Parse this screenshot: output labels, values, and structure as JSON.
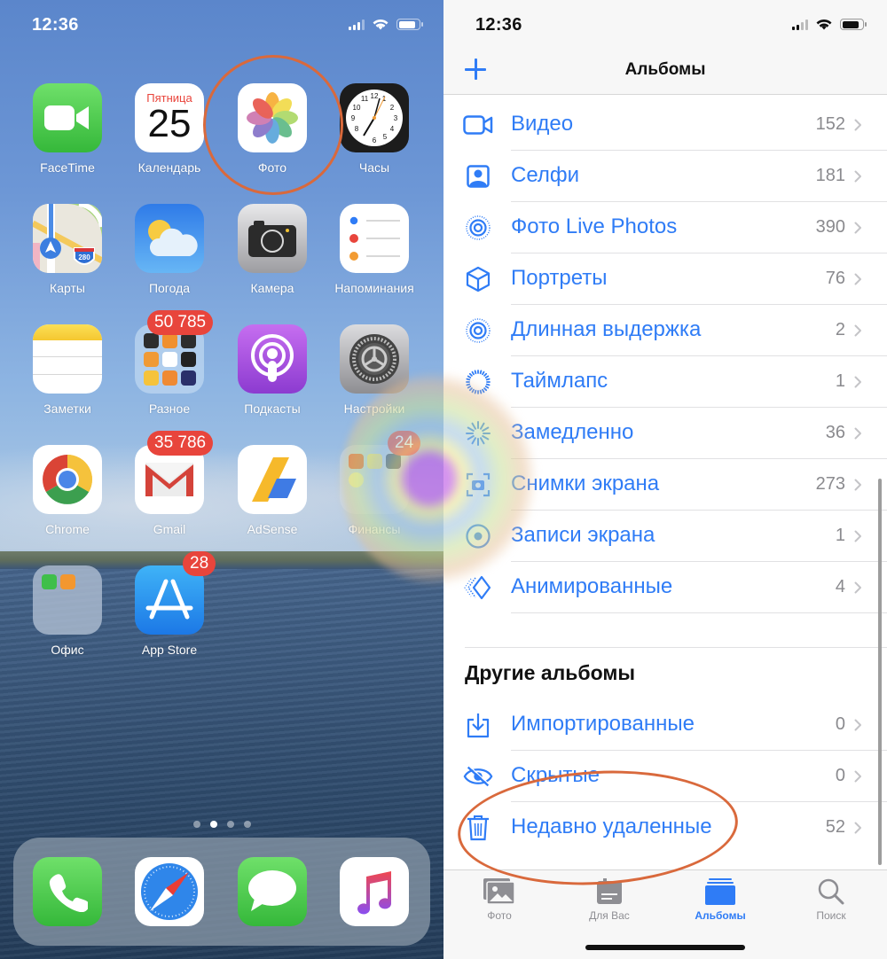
{
  "home_screen": {
    "status_bar": {
      "time": "12:36"
    },
    "apps": [
      {
        "name": "FaceTime",
        "icon": "facetime-icon"
      },
      {
        "name": "Календарь",
        "icon": "calendar-icon",
        "weekday": "Пятница",
        "day": "25"
      },
      {
        "name": "Фото",
        "icon": "photos-icon",
        "highlighted": true
      },
      {
        "name": "Часы",
        "icon": "clock-icon"
      },
      {
        "name": "Карты",
        "icon": "maps-icon",
        "route_shield": "280"
      },
      {
        "name": "Погода",
        "icon": "weather-icon"
      },
      {
        "name": "Камера",
        "icon": "camera-icon"
      },
      {
        "name": "Напоминания",
        "icon": "reminders-icon"
      },
      {
        "name": "Заметки",
        "icon": "notes-icon"
      },
      {
        "name": "Разное",
        "icon": "folder-icon",
        "badge": "50 785"
      },
      {
        "name": "Подкасты",
        "icon": "podcasts-icon"
      },
      {
        "name": "Настройки",
        "icon": "settings-icon"
      },
      {
        "name": "Chrome",
        "icon": "chrome-icon"
      },
      {
        "name": "Gmail",
        "icon": "gmail-icon",
        "badge": "35 786"
      },
      {
        "name": "AdSense",
        "icon": "adsense-icon"
      },
      {
        "name": "Финансы",
        "icon": "folder-icon",
        "badge": "24"
      },
      {
        "name": "Офис",
        "icon": "folder-icon"
      },
      {
        "name": "App Store",
        "icon": "appstore-icon",
        "badge": "28"
      }
    ],
    "page_indicator": {
      "pages": 4,
      "current": 2
    },
    "dock": [
      {
        "name": "Телефон",
        "icon": "phone-icon"
      },
      {
        "name": "Safari",
        "icon": "safari-icon"
      },
      {
        "name": "Сообщения",
        "icon": "messages-icon"
      },
      {
        "name": "Музыка",
        "icon": "music-icon"
      }
    ]
  },
  "albums_screen": {
    "status_bar": {
      "time": "12:36"
    },
    "nav": {
      "title": "Альбомы",
      "add_button": "plus-icon"
    },
    "media_types": [
      {
        "label": "Видео",
        "count": "152",
        "icon": "video-icon"
      },
      {
        "label": "Селфи",
        "count": "181",
        "icon": "selfie-icon"
      },
      {
        "label": "Фото Live Photos",
        "count": "390",
        "icon": "live-photos-icon"
      },
      {
        "label": "Портреты",
        "count": "76",
        "icon": "portrait-cube-icon"
      },
      {
        "label": "Длинная выдержка",
        "count": "2",
        "icon": "long-exposure-icon"
      },
      {
        "label": "Таймлапс",
        "count": "1",
        "icon": "timelapse-icon"
      },
      {
        "label": "Замедленно",
        "count": "36",
        "icon": "slo-mo-icon"
      },
      {
        "label": "Снимки экрана",
        "count": "273",
        "icon": "screenshot-icon"
      },
      {
        "label": "Записи экрана",
        "count": "1",
        "icon": "screen-recording-icon"
      },
      {
        "label": "Анимированные",
        "count": "4",
        "icon": "animated-icon"
      }
    ],
    "other_albums": {
      "title": "Другие альбомы",
      "items": [
        {
          "label": "Импортированные",
          "count": "0",
          "icon": "import-icon"
        },
        {
          "label": "Скрытые",
          "count": "0",
          "icon": "hidden-eye-icon"
        },
        {
          "label": "Недавно удаленные",
          "count": "52",
          "icon": "trash-icon",
          "highlighted": true
        }
      ]
    },
    "tabs": [
      {
        "label": "Фото",
        "icon": "photos-tab-icon",
        "active": false
      },
      {
        "label": "Для Вас",
        "icon": "for-you-tab-icon",
        "active": false
      },
      {
        "label": "Альбомы",
        "icon": "albums-tab-icon",
        "active": true
      },
      {
        "label": "Поиск",
        "icon": "search-tab-icon",
        "active": false
      }
    ]
  },
  "colors": {
    "accent_blue": "#2f7cf6",
    "badge_red": "#e8453c",
    "annotation_orange": "#d9693c",
    "count_gray": "#8a8a8e"
  }
}
